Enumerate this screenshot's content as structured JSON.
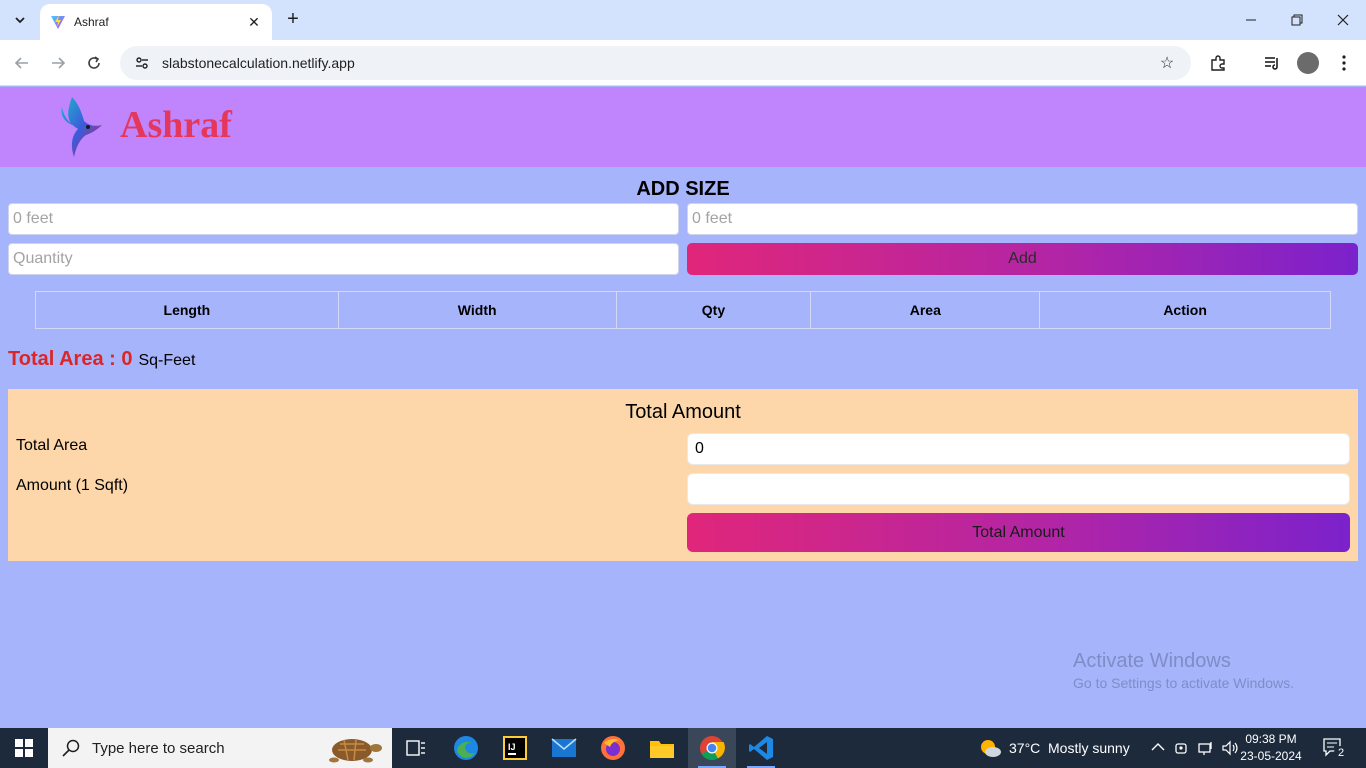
{
  "browser": {
    "tab_title": "Ashraf",
    "url": "slabstonecalculation.netlify.app"
  },
  "site": {
    "brand": "Ashraf"
  },
  "add_size": {
    "title": "ADD SIZE",
    "length_placeholder": "0 feet",
    "width_placeholder": "0 feet",
    "quantity_placeholder": "Quantity",
    "add_label": "Add"
  },
  "table": {
    "headers": [
      "Length",
      "Width",
      "Qty",
      "Area",
      "Action"
    ]
  },
  "total_area": {
    "label": "Total Area : 0",
    "unit": "Sq-Feet"
  },
  "amount_panel": {
    "title": "Total Amount",
    "total_area_label": "Total Area",
    "total_area_value": "0",
    "amount_label": "Amount (1 Sqft)",
    "amount_value": "",
    "button_label": "Total Amount"
  },
  "watermark": {
    "line1": "Activate Windows",
    "line2": "Go to Settings to activate Windows."
  },
  "taskbar": {
    "search_placeholder": "Type here to search",
    "weather_temp": "37°C",
    "weather_text": "Mostly sunny",
    "time": "09:38 PM",
    "date": "23-05-2024",
    "notification_count": "2"
  },
  "colors": {
    "page_bg": "#a6b4fb",
    "header_bg": "#c084fc",
    "brand": "#e5375c",
    "amount_panel_bg": "#fdd7aa",
    "total_area_red": "#dc2626"
  }
}
